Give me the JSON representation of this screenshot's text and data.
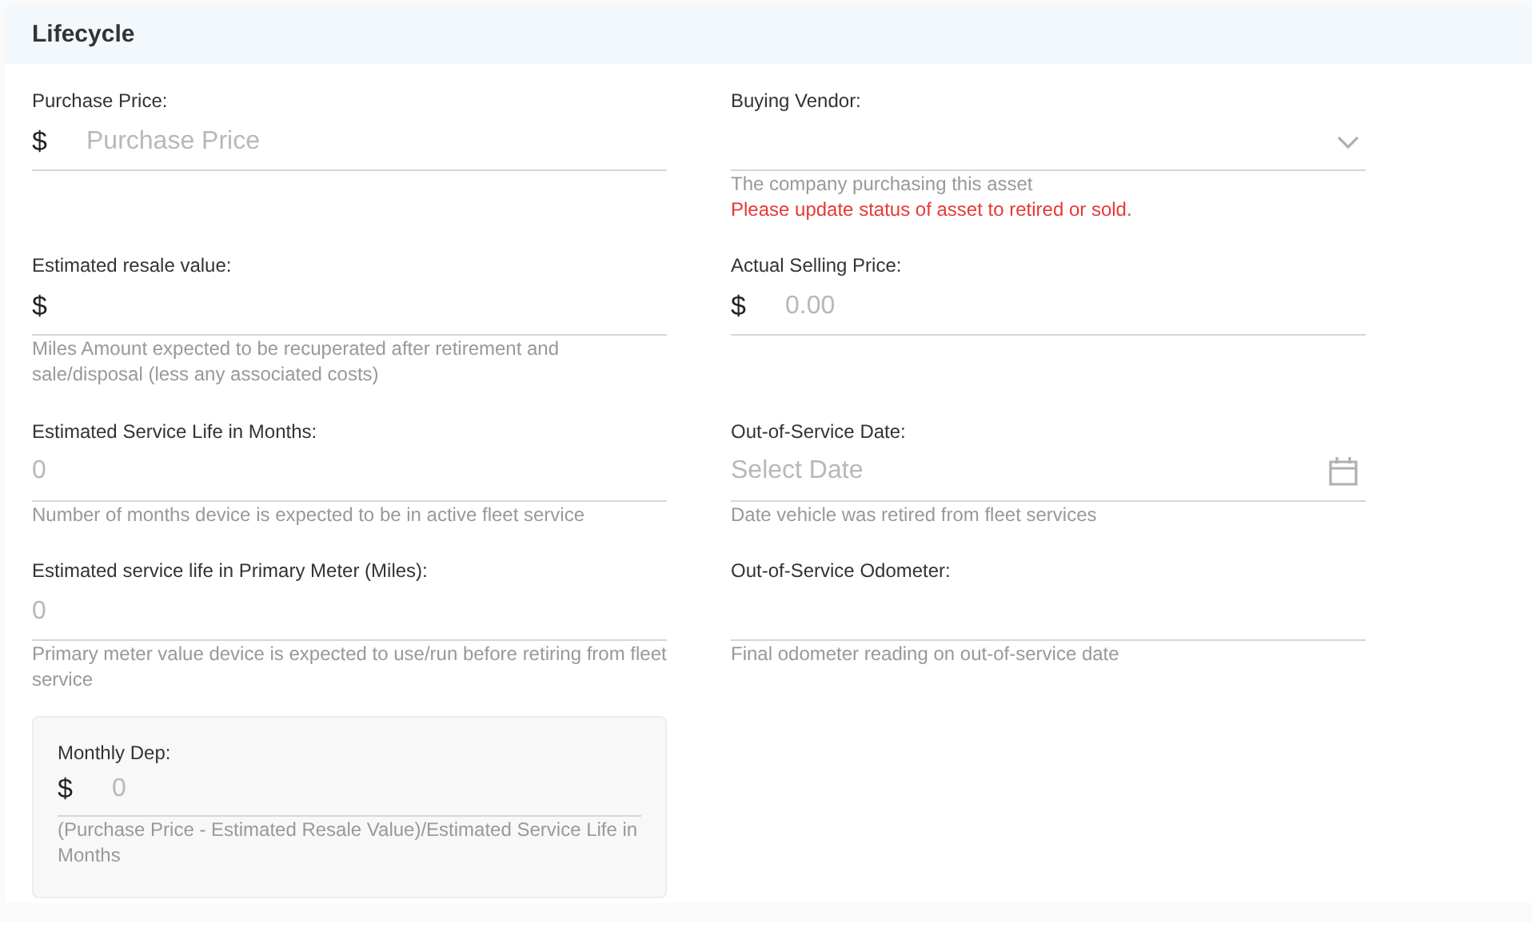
{
  "section": {
    "title": "Lifecycle"
  },
  "fields": [
    {
      "kind": "currency",
      "label": "Purchase Price:",
      "prefix": "$",
      "placeholder": "Purchase Price"
    },
    {
      "kind": "select",
      "label": "Buying Vendor:",
      "hints": [
        {
          "kind": "help",
          "text": "The company purchasing this asset"
        },
        {
          "kind": "error",
          "text": "Please update status of asset to retired or sold."
        }
      ]
    },
    {
      "kind": "currency",
      "label": "Estimated resale value:",
      "prefix": "$",
      "hints": [
        {
          "kind": "help",
          "text": "Miles Amount expected to be recuperated after retirement and sale/disposal (less any associated costs)"
        }
      ]
    },
    {
      "kind": "currency",
      "label": "Actual Selling Price:",
      "prefix": "$",
      "placeholder": "0.00"
    },
    {
      "kind": "number",
      "label": "Estimated Service Life in Months:",
      "placeholder": "0",
      "hints": [
        {
          "kind": "help",
          "text": "Number of months device is expected to be in active fleet service"
        }
      ]
    },
    {
      "kind": "date",
      "label": "Out-of-Service Date:",
      "placeholder": "Select Date",
      "hints": [
        {
          "kind": "help",
          "text": "Date vehicle was retired from fleet services"
        }
      ]
    },
    {
      "kind": "number",
      "label": "Estimated service life in Primary Meter (Miles):",
      "placeholder": "0",
      "hints": [
        {
          "kind": "help",
          "text": "Primary meter value device is expected to use/run before retiring from fleet service"
        }
      ]
    },
    {
      "kind": "number",
      "label": "Out-of-Service Odometer:",
      "hints": [
        {
          "kind": "help",
          "text": "Final odometer reading on out-of-service date"
        }
      ]
    },
    {
      "kind": "summary",
      "label": "Monthly Dep:",
      "prefix": "$",
      "placeholder": "0",
      "hints": [
        {
          "kind": "help",
          "text": "(Purchase Price - Estimated Resale Value)/Estimated Service Life in Months"
        }
      ]
    }
  ]
}
